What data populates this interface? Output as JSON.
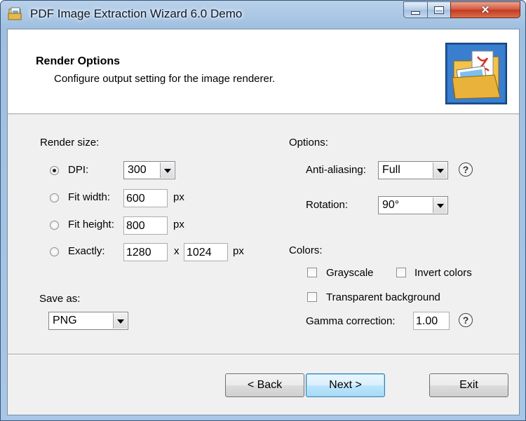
{
  "window": {
    "title": "PDF Image Extraction Wizard 6.0 Demo"
  },
  "header": {
    "title": "Render Options",
    "subtitle": "Configure output setting for the image renderer."
  },
  "render_size": {
    "label": "Render size:",
    "dpi": {
      "label": "DPI:",
      "value": "300",
      "selected": true
    },
    "fit_width": {
      "label": "Fit width:",
      "value": "600",
      "unit": "px"
    },
    "fit_height": {
      "label": "Fit height:",
      "value": "800",
      "unit": "px"
    },
    "exactly": {
      "label": "Exactly:",
      "width": "1280",
      "sep": "x",
      "height": "1024",
      "unit": "px"
    }
  },
  "save_as": {
    "label": "Save as:",
    "value": "PNG"
  },
  "options": {
    "label": "Options:",
    "anti_aliasing": {
      "label": "Anti-aliasing:",
      "value": "Full"
    },
    "rotation": {
      "label": "Rotation:",
      "value": "90°"
    },
    "help_glyph": "?"
  },
  "colors": {
    "label": "Colors:",
    "grayscale": {
      "label": "Grayscale",
      "checked": false
    },
    "invert": {
      "label": "Invert colors",
      "checked": false
    },
    "transparent": {
      "label": "Transparent background",
      "checked": false
    },
    "gamma": {
      "label": "Gamma correction:",
      "value": "1.00"
    }
  },
  "buttons": {
    "back": "< Back",
    "next": "Next >",
    "exit": "Exit"
  },
  "icons": {
    "app": "app-wizard-icon",
    "header": "folder-pdf-image-icon"
  }
}
